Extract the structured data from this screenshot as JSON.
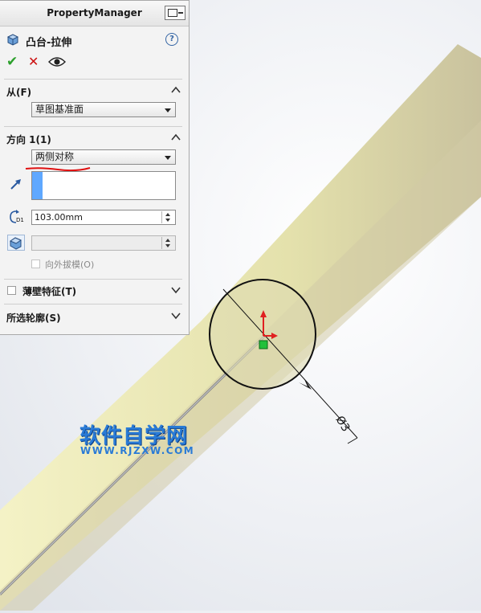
{
  "property_manager": {
    "header": "PropertyManager",
    "feature_title": "凸台-拉伸",
    "help": "?",
    "actions": {
      "ok": "✔",
      "cancel": "✕"
    },
    "from": {
      "title": "从(F)",
      "value": "草图基准面"
    },
    "direction1": {
      "title": "方向 1(1)",
      "end_condition": "两侧对称",
      "depth": "103.00mm",
      "draft_outward": "向外拔模(O)"
    },
    "thin_feature": {
      "title": "薄壁特征(T)"
    },
    "selected_contours": {
      "title": "所选轮廓(S)"
    }
  },
  "viewport": {
    "dimension_label": "Ø3",
    "watermark_main": "软件自学网",
    "watermark_url": "WWW.RJZXW.COM"
  },
  "colors": {
    "cylinder": "#e8e6b0",
    "accent_blue": "#5fa8ff",
    "underline_red": "#e01010",
    "watermark": "#2a7bd6"
  }
}
